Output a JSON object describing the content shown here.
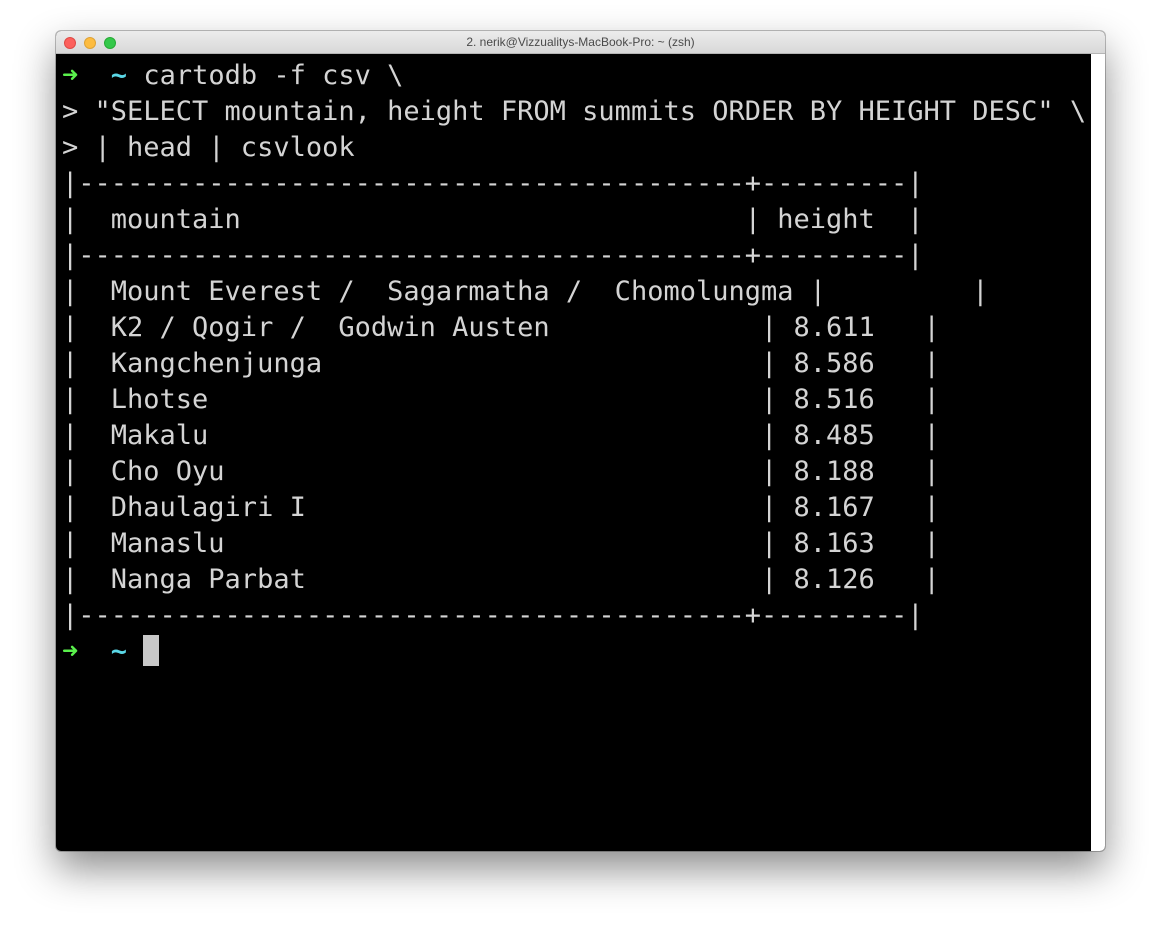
{
  "window": {
    "title": "2. nerik@Vizzualitys-MacBook-Pro: ~ (zsh)"
  },
  "prompt": {
    "arrow": "➜",
    "dir": "~"
  },
  "command": {
    "line1": "cartodb -f csv \\",
    "line2": "> \"SELECT mountain, height FROM summits ORDER BY HEIGHT DESC\" \\",
    "line3": "> | head | csvlook"
  },
  "table": {
    "border_top": "|-----------------------------------------+---------|",
    "header": "|  mountain                               | height  |",
    "border_mid": "|-----------------------------------------+---------|",
    "rows": [
      "|  Mount Everest /  Sagarmatha /  Chomolungma |         |",
      "|  K2 / Qogir /  Godwin Austen             | 8.611   |",
      "|  Kangchenjunga                           | 8.586   |",
      "|  Lhotse                                  | 8.516   |",
      "|  Makalu                                  | 8.485   |",
      "|  Cho Oyu                                 | 8.188   |",
      "|  Dhaulagiri I                            | 8.167   |",
      "|  Manaslu                                 | 8.163   |",
      "|  Nanga Parbat                            | 8.126   |"
    ],
    "border_bottom": "|-----------------------------------------+---------|"
  },
  "colors": {
    "background": "#000000",
    "text": "#d4d4d4",
    "arrow": "#5af04c",
    "tilde": "#5ad7e6",
    "cursor": "#c8c8c8"
  }
}
